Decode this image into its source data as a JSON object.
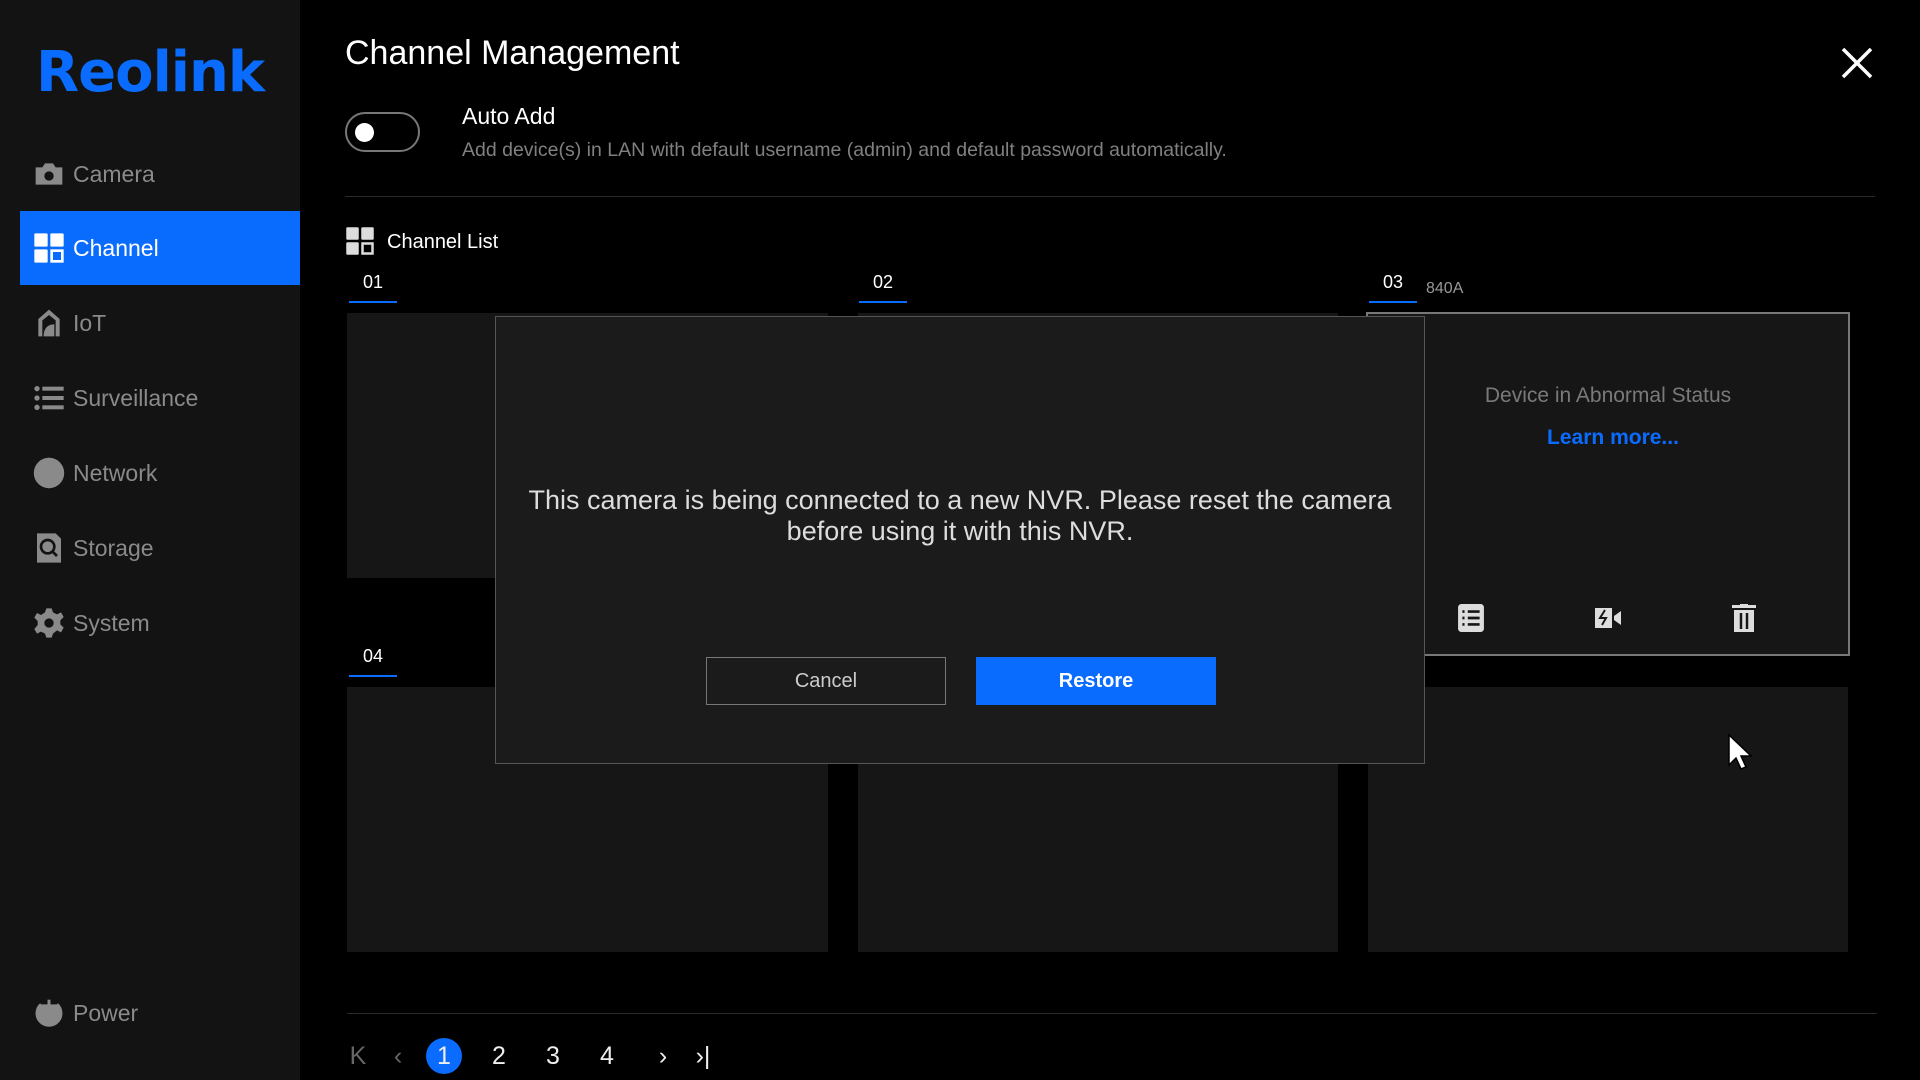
{
  "brand": {
    "logo": "Reolink",
    "accent": "#0a6cff"
  },
  "sidebar": {
    "items": [
      {
        "label": "Camera",
        "icon": "camera-icon"
      },
      {
        "label": "Channel",
        "icon": "grid-icon",
        "active": true
      },
      {
        "label": "IoT",
        "icon": "home-icon"
      },
      {
        "label": "Surveillance",
        "icon": "list-icon"
      },
      {
        "label": "Network",
        "icon": "globe-icon"
      },
      {
        "label": "Storage",
        "icon": "storage-icon"
      },
      {
        "label": "System",
        "icon": "gear-icon"
      }
    ],
    "power": "Power"
  },
  "header": {
    "title": "Channel Management"
  },
  "auto_add": {
    "label": "Auto Add",
    "description": "Add device(s) in LAN with default username (admin) and default password automatically.",
    "enabled": false
  },
  "channel_list": {
    "label": "Channel List",
    "channels": [
      {
        "number": "01"
      },
      {
        "number": "02"
      },
      {
        "number": "03",
        "name": "840A",
        "status": "Device in Abnormal Status",
        "link": "Learn more..."
      },
      {
        "number": "04"
      }
    ]
  },
  "dialog": {
    "message": "This camera is being connected to a new NVR. Please reset the camera before using it with this NVR.",
    "cancel": "Cancel",
    "confirm": "Restore"
  },
  "pagination": {
    "pages": [
      "1",
      "2",
      "3",
      "4"
    ],
    "current": "1"
  }
}
